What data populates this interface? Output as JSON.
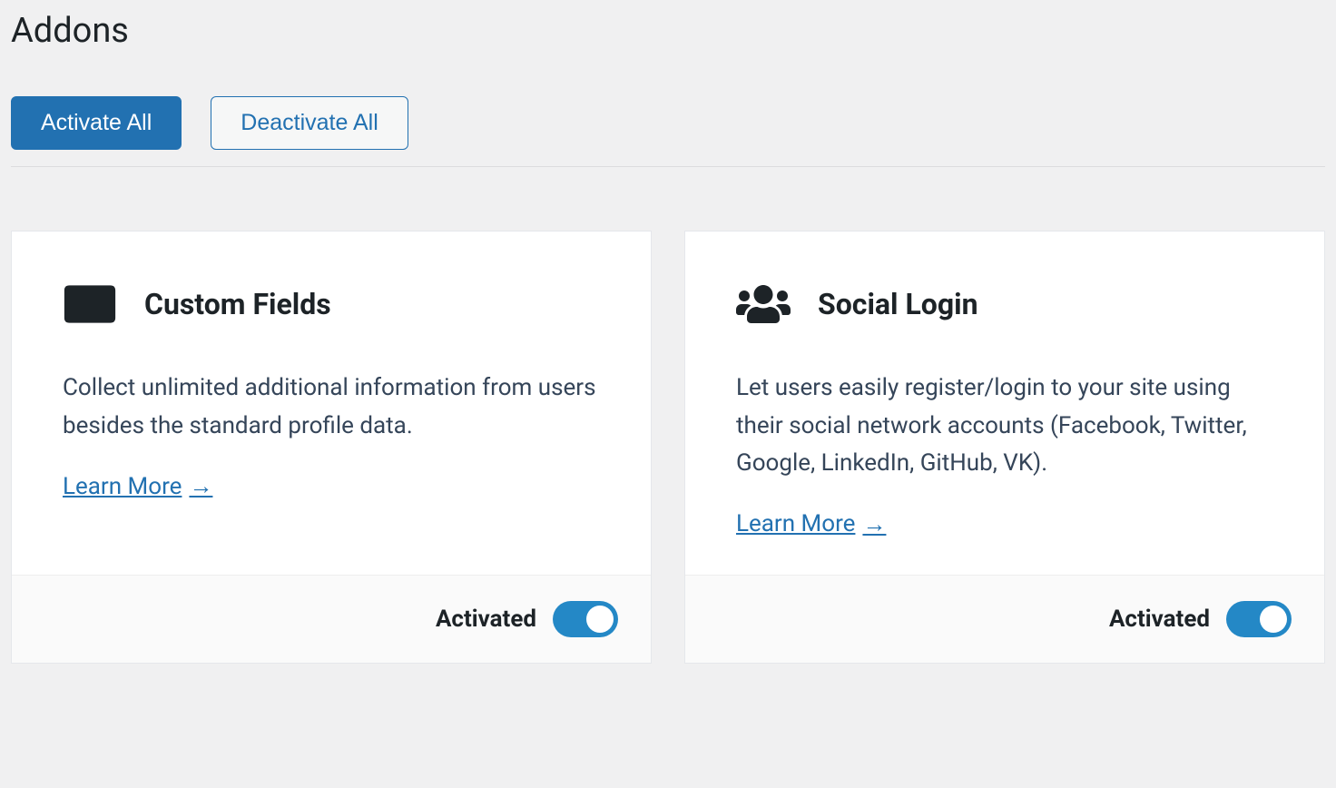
{
  "page": {
    "title": "Addons"
  },
  "buttons": {
    "activate_all": "Activate All",
    "deactivate_all": "Deactivate All"
  },
  "addons": [
    {
      "title": "Custom Fields",
      "description": "Collect unlimited additional information from users besides the standard profile data.",
      "learn_more": "Learn More",
      "status": "Activated",
      "activated": true
    },
    {
      "title": "Social Login",
      "description": "Let users easily register/login to your site using their social network accounts (Facebook, Twitter, Google, LinkedIn, GitHub, VK).",
      "learn_more": "Learn More",
      "status": "Activated",
      "activated": true
    }
  ]
}
